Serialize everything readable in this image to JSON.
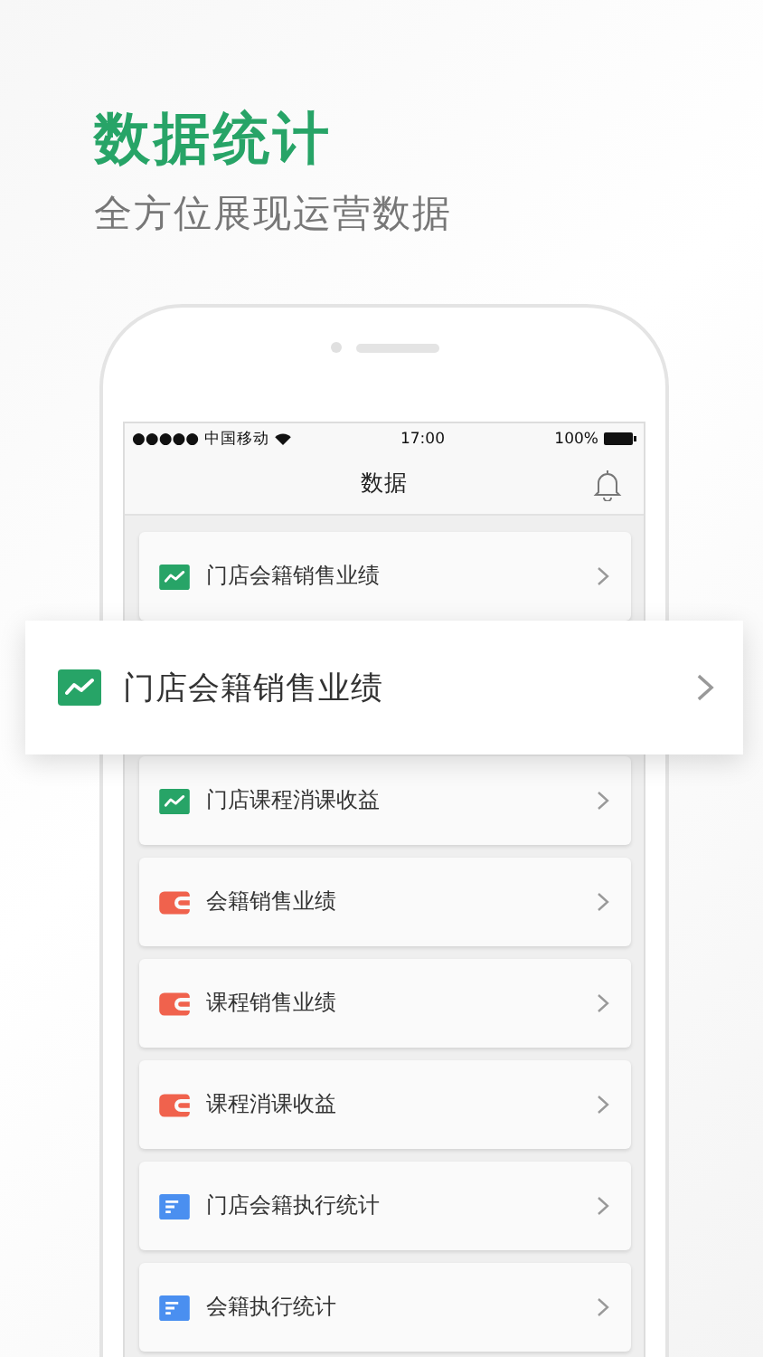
{
  "headline": "数据统计",
  "subtitle": "全方位展现运营数据",
  "status_bar": {
    "carrier": "●●●●● 中国移动",
    "time": "17:00",
    "battery": "100%"
  },
  "nav": {
    "title": "数据"
  },
  "items": [
    {
      "kind": "trend",
      "label": "门店会籍销售业绩",
      "highlighted": false
    },
    {
      "kind": "trend",
      "label": "门店会籍销售业绩",
      "highlighted": true
    },
    {
      "kind": "trend",
      "label": "门店课程消课收益",
      "highlighted": false
    },
    {
      "kind": "wallet",
      "label": "会籍销售业绩",
      "highlighted": false
    },
    {
      "kind": "wallet",
      "label": "课程销售业绩",
      "highlighted": false
    },
    {
      "kind": "wallet",
      "label": "课程消课收益",
      "highlighted": false
    },
    {
      "kind": "doc",
      "label": "门店会籍执行统计",
      "highlighted": false
    },
    {
      "kind": "doc",
      "label": "会籍执行统计",
      "highlighted": false
    }
  ]
}
